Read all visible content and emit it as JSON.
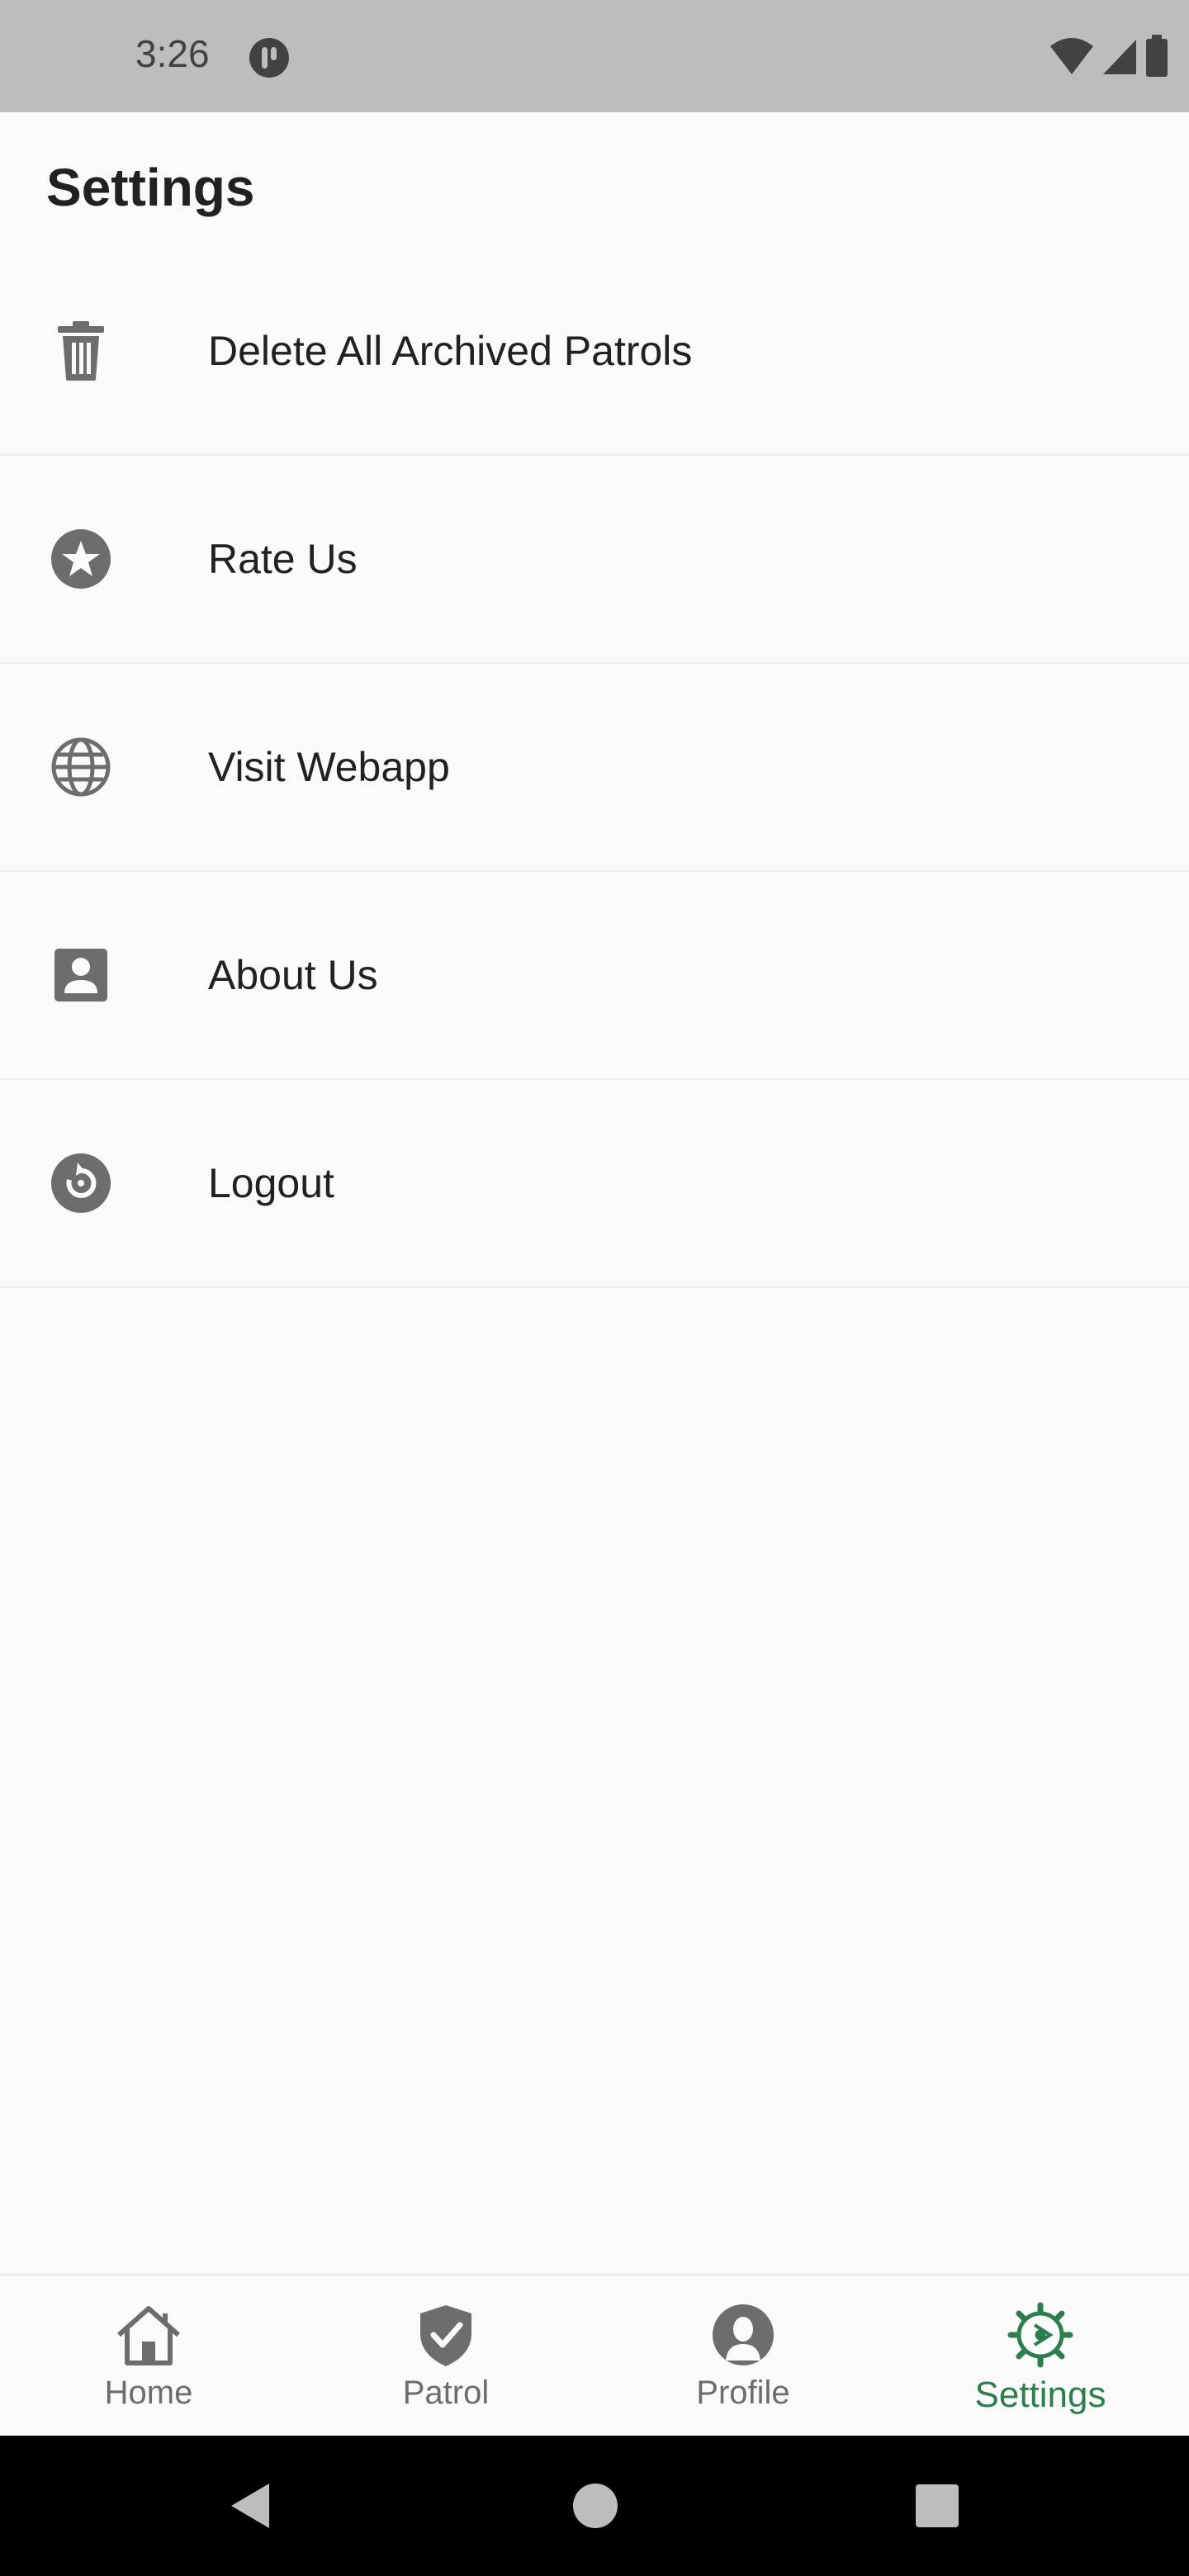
{
  "status_bar": {
    "time": "3:26",
    "icons": [
      "app-notification-icon",
      "wifi-icon",
      "cellular-signal-icon",
      "battery-icon"
    ]
  },
  "page": {
    "title": "Settings"
  },
  "settings_items": [
    {
      "label": "Delete All Archived Patrols",
      "icon": "trash-icon"
    },
    {
      "label": "Rate Us",
      "icon": "star-circle-icon"
    },
    {
      "label": "Visit Webapp",
      "icon": "globe-icon"
    },
    {
      "label": "About Us",
      "icon": "contact-card-icon"
    },
    {
      "label": "Logout",
      "icon": "restart-circle-icon"
    }
  ],
  "bottom_nav": {
    "items": [
      {
        "label": "Home",
        "icon": "home-icon",
        "active": false
      },
      {
        "label": "Patrol",
        "icon": "shield-check-icon",
        "active": false
      },
      {
        "label": "Profile",
        "icon": "profile-icon",
        "active": false
      },
      {
        "label": "Settings",
        "icon": "gear-icon",
        "active": true
      }
    ]
  },
  "system_nav": {
    "buttons": [
      "back-icon",
      "home-circle-icon",
      "recents-square-icon"
    ]
  },
  "colors": {
    "accent": "#2e7d4f",
    "icon_gray": "#6d6d6d",
    "status_bar": "#bdbdbd",
    "background": "#fafafa"
  }
}
